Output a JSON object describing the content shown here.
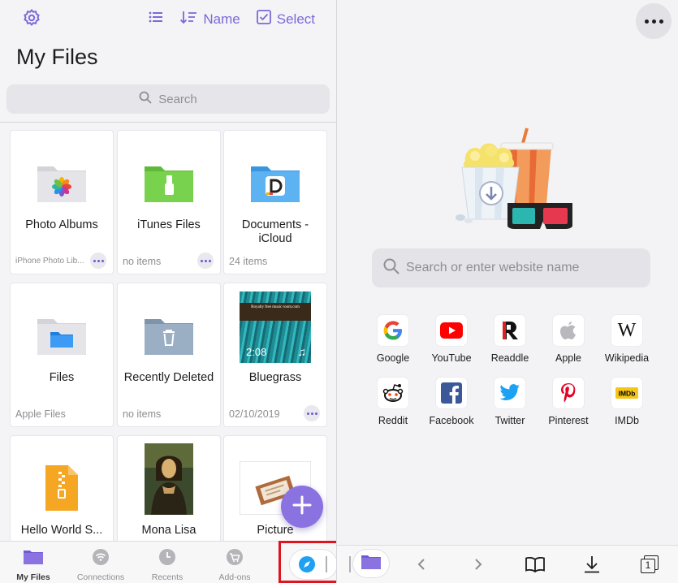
{
  "files": {
    "toolbar": {
      "sort_label": "Name",
      "select_label": "Select"
    },
    "title": "My Files",
    "search_placeholder": "Search",
    "items": [
      {
        "name": "Photo Albums",
        "meta": "iPhone Photo Lib...",
        "icon": "photos-folder-icon"
      },
      {
        "name": "iTunes Files",
        "meta": "no items",
        "icon": "itunes-folder-icon"
      },
      {
        "name": "Documents - iCloud",
        "meta": "24 items",
        "icon": "documents-folder-icon"
      },
      {
        "name": "Files",
        "meta": "Apple Files",
        "icon": "files-folder-icon"
      },
      {
        "name": "Recently Deleted",
        "meta": "no items",
        "icon": "trash-folder-icon"
      },
      {
        "name": "Bluegrass",
        "meta": "02/10/2019",
        "duration": "2:08",
        "thumb_caption": "Royalty free music room.com",
        "icon": "audio-thumbnail"
      },
      {
        "name": "Hello World S...",
        "meta": "",
        "icon": "zip-file-icon"
      },
      {
        "name": "Mona Lisa",
        "meta": "",
        "icon": "image-thumbnail"
      },
      {
        "name": "Picture",
        "meta": "",
        "icon": "image-thumbnail"
      }
    ],
    "tabs": [
      {
        "label": "My Files",
        "active": true
      },
      {
        "label": "Connections",
        "active": false
      },
      {
        "label": "Recents",
        "active": false
      },
      {
        "label": "Add-ons",
        "active": false
      }
    ],
    "accent": "#7b68d9"
  },
  "browser": {
    "search_placeholder": "Search or enter website name",
    "favorites": [
      {
        "label": "Google",
        "icon": "google-icon"
      },
      {
        "label": "YouTube",
        "icon": "youtube-icon"
      },
      {
        "label": "Readdle",
        "icon": "readdle-icon"
      },
      {
        "label": "Apple",
        "icon": "apple-icon"
      },
      {
        "label": "Wikipedia",
        "icon": "wikipedia-icon"
      },
      {
        "label": "Reddit",
        "icon": "reddit-icon"
      },
      {
        "label": "Facebook",
        "icon": "facebook-icon"
      },
      {
        "label": "Twitter",
        "icon": "twitter-icon"
      },
      {
        "label": "Pinterest",
        "icon": "pinterest-icon"
      },
      {
        "label": "IMDb",
        "icon": "imdb-icon"
      }
    ],
    "tab_count": "1"
  }
}
